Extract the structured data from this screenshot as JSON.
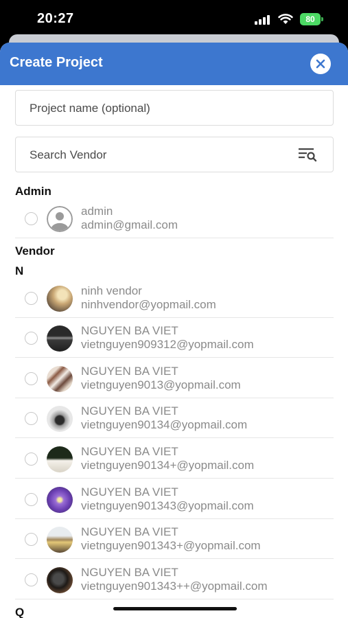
{
  "status_bar": {
    "time": "20:27",
    "battery": "80",
    "icons": [
      "signal-icon",
      "wifi-icon",
      "battery-icon"
    ]
  },
  "header": {
    "title": "Create Project",
    "close_icon": "close-icon",
    "accent_color": "#3d77cf"
  },
  "form": {
    "project_name_placeholder": "Project name (optional)",
    "search_placeholder": "Search Vendor",
    "filter_icon": "search-filter-icon"
  },
  "sections": {
    "admin_label": "Admin",
    "vendor_label": "Vendor",
    "group_n": "N",
    "group_q": "Q"
  },
  "admin": {
    "name": "admin",
    "email": "admin@gmail.com",
    "avatar": "default-user-icon",
    "selected": false
  },
  "vendors": [
    {
      "name": "ninh vendor",
      "email": "ninhvendor@yopmail.com",
      "selected": false
    },
    {
      "name": "NGUYEN BA VIET",
      "email": "vietnguyen909312@yopmail.com",
      "selected": false
    },
    {
      "name": "NGUYEN BA VIET",
      "email": "vietnguyen9013@yopmail.com",
      "selected": false
    },
    {
      "name": "NGUYEN BA VIET",
      "email": "vietnguyen90134@yopmail.com",
      "selected": false
    },
    {
      "name": "NGUYEN BA VIET",
      "email": "vietnguyen90134+@yopmail.com",
      "selected": false
    },
    {
      "name": "NGUYEN BA VIET",
      "email": "vietnguyen901343@yopmail.com",
      "selected": false
    },
    {
      "name": "NGUYEN BA VIET",
      "email": "vietnguyen901343+@yopmail.com",
      "selected": false
    },
    {
      "name": "NGUYEN BA VIET",
      "email": "vietnguyen901343++@yopmail.com",
      "selected": false
    }
  ]
}
